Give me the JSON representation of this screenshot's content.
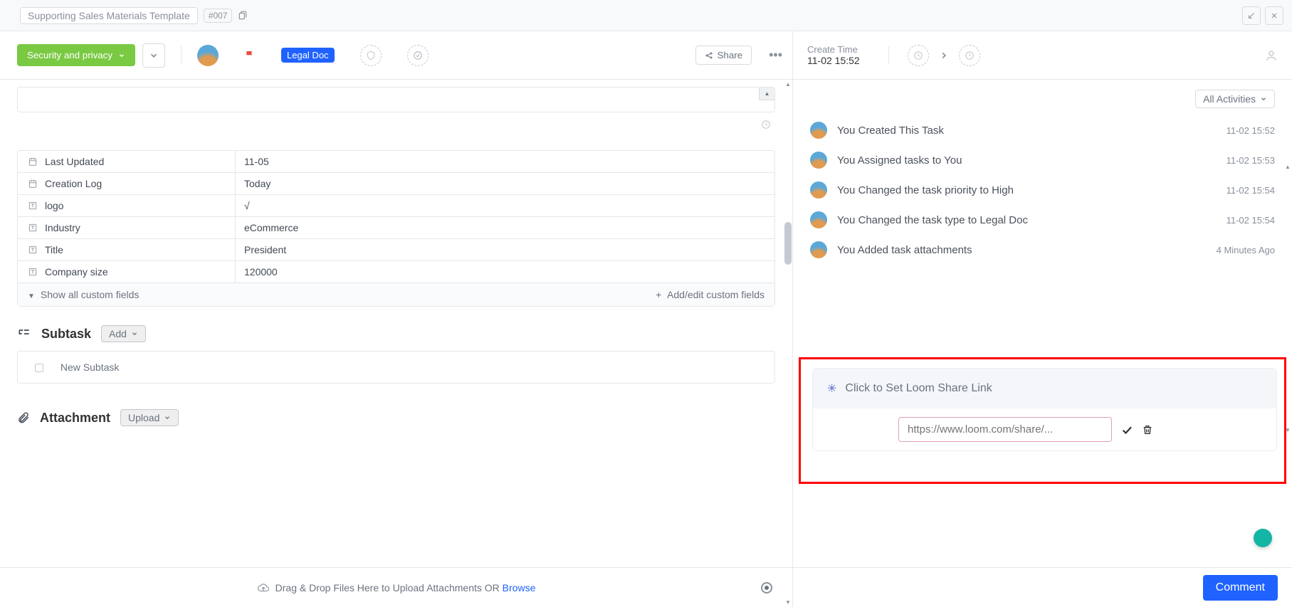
{
  "title": {
    "name": "Supporting Sales Materials Template",
    "num": "#007"
  },
  "toolbar": {
    "status": "Security and privacy",
    "type_badge": "Legal Doc",
    "share": "Share",
    "create_label": "Create Time",
    "create_value": "11-02 15:52"
  },
  "fields": [
    {
      "icon": "calendar",
      "label": "Last Updated",
      "value": "11-05"
    },
    {
      "icon": "calendar",
      "label": "Creation Log",
      "value": "Today"
    },
    {
      "icon": "text",
      "label": "logo",
      "value": "√"
    },
    {
      "icon": "text",
      "label": "Industry",
      "value": "eCommerce"
    },
    {
      "icon": "text",
      "label": "Title",
      "value": "President"
    },
    {
      "icon": "text",
      "label": "Company size",
      "value": "120000"
    }
  ],
  "fields_footer": {
    "show_all": "Show all custom fields",
    "add_edit": "Add/edit custom fields"
  },
  "subtask": {
    "title": "Subtask",
    "add": "Add",
    "placeholder": "New Subtask"
  },
  "attachment": {
    "title": "Attachment",
    "upload": "Upload"
  },
  "dropbar": {
    "text": "Drag & Drop Files Here to Upload Attachments OR ",
    "browse": "Browse"
  },
  "activities": {
    "filter": "All Activities",
    "items": [
      {
        "text": "You Created This Task",
        "time": "11-02 15:52"
      },
      {
        "text": "You Assigned tasks to You",
        "time": "11-02 15:53"
      },
      {
        "text": "You Changed the task priority to High",
        "time": "11-02 15:54"
      },
      {
        "text": "You Changed the task type to Legal Doc",
        "time": "11-02 15:54"
      },
      {
        "text": "You Added task attachments",
        "time": "4 Minutes Ago"
      }
    ]
  },
  "loom": {
    "header": "Click to Set Loom Share Link",
    "placeholder": "https://www.loom.com/share/..."
  },
  "comment_btn": "Comment"
}
